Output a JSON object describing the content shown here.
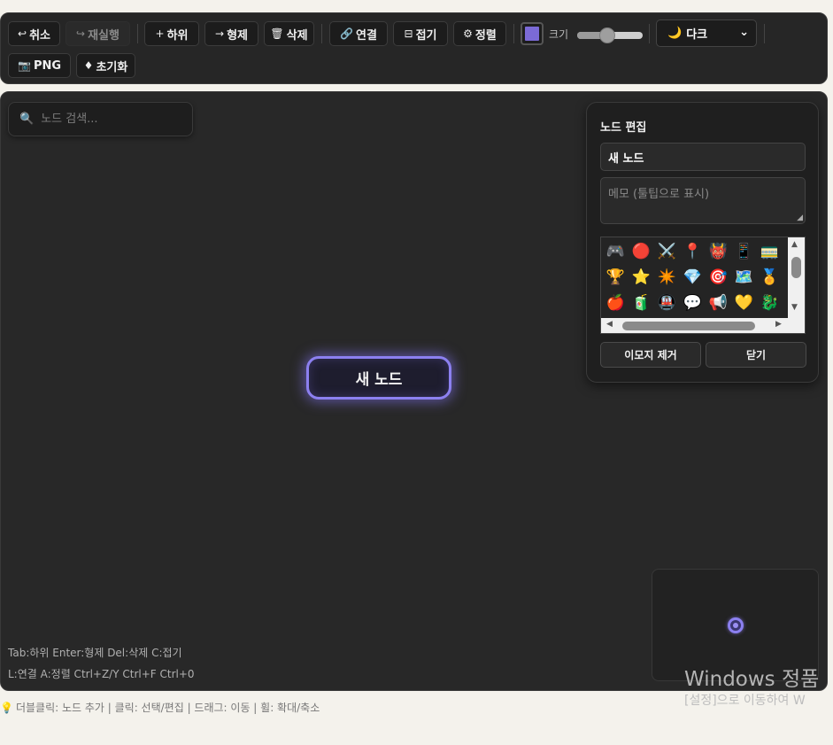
{
  "toolbar": {
    "undo": {
      "icon": "↩",
      "label": "취소"
    },
    "redo": {
      "icon": "↪",
      "label": "재실행"
    },
    "add_child": {
      "icon": "+",
      "label": "하위"
    },
    "add_sibling": {
      "icon": "→",
      "label": "형제"
    },
    "delete": {
      "icon": "🗑",
      "label": "삭제"
    },
    "connect": {
      "icon": "🔗",
      "label": "연결"
    },
    "collapse": {
      "icon": "⊟",
      "label": "접기"
    },
    "arrange": {
      "icon": "⚙",
      "label": "정렬"
    },
    "node_color": "#7b6ad6",
    "size_label": "크기",
    "size_value": 0.45,
    "theme": {
      "icon": "🌙",
      "selected": "다크",
      "chevron": "⌄"
    },
    "export_png": {
      "icon": "📷",
      "label": "PNG"
    },
    "reset": {
      "icon": "♦",
      "label": "초기화"
    }
  },
  "search": {
    "icon": "🔍",
    "placeholder": "노드 검색..."
  },
  "canvas": {
    "node_label": "새 노드",
    "node_border_color": "#8c80f0",
    "hint_line1": "Tab:하위 Enter:형제 Del:삭제 C:접기",
    "hint_line2": "L:연결 A:정렬 Ctrl+Z/Y Ctrl+F Ctrl+0"
  },
  "edit_panel": {
    "title": "노드 편집",
    "name_value": "새 노드",
    "memo_placeholder": "메모 (툴팁으로 표시)",
    "emojis": [
      "🎮",
      "🔴",
      "⚔️",
      "📍",
      "👹",
      "📱",
      "🚃",
      "🏆",
      "⭐",
      "✴️",
      "💎",
      "🎯",
      "🗺️",
      "🏅",
      "🍎",
      "🧃",
      "🚇",
      "💬",
      "📢",
      "💛",
      "🐉"
    ],
    "remove_emoji_label": "이모지 제거",
    "close_label": "닫기"
  },
  "watermark": {
    "line1": "Windows 정품",
    "line2": "[설정]으로 이동하여 W"
  },
  "footer": {
    "icon": "💡",
    "text": "더블클릭: 노드 추가 | 클릭: 선택/편집 | 드래그: 이동 | 휠: 확대/축소"
  }
}
